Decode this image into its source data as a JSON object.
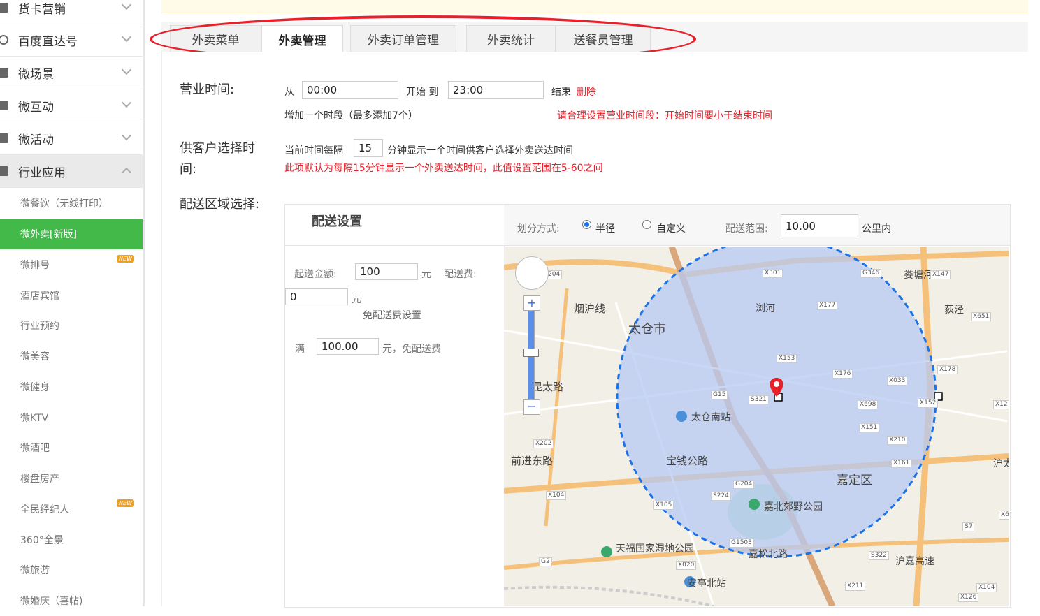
{
  "sidebar": {
    "items": [
      {
        "label": "货卡营销",
        "icon": "card-icon"
      },
      {
        "label": "百度直达号",
        "icon": "baidu-icon"
      },
      {
        "label": "微场景",
        "icon": "scene-icon"
      },
      {
        "label": "微互动",
        "icon": "interact-icon"
      },
      {
        "label": "微活动",
        "icon": "activity-icon"
      },
      {
        "label": "行业应用",
        "icon": "industry-icon"
      }
    ],
    "sub_items": [
      {
        "label": "微餐饮（无线打印）"
      },
      {
        "label": "微外卖[新版]"
      },
      {
        "label": "微排号",
        "badge": "NEW"
      },
      {
        "label": "酒店宾馆"
      },
      {
        "label": "行业预约"
      },
      {
        "label": "微美容"
      },
      {
        "label": "微健身"
      },
      {
        "label": "微KTV"
      },
      {
        "label": "微酒吧"
      },
      {
        "label": "楼盘房产"
      },
      {
        "label": "全民经纪人",
        "badge": "NEW"
      },
      {
        "label": "360°全景"
      },
      {
        "label": "微旅游"
      },
      {
        "label": "微婚庆（喜帖)"
      }
    ]
  },
  "tabs": [
    {
      "label": "外卖菜单"
    },
    {
      "label": "外卖管理"
    },
    {
      "label": "外卖订单管理"
    },
    {
      "label": "外卖统计"
    },
    {
      "label": "送餐员管理"
    }
  ],
  "business_hours": {
    "label": "营业时间:",
    "from": "从",
    "start_value": "00:00",
    "start_to": "开始 到",
    "end_value": "23:00",
    "end": "结束",
    "delete": "删除",
    "add_period": "增加一个时段（最多添加7个）",
    "warning": "请合理设置营业时间段：开始时间要小于结束时间"
  },
  "customer_time": {
    "label_line1": "供客户选择时",
    "label_line2": "间:",
    "prefix": "当前时间每隔",
    "interval_value": "15",
    "suffix": "分钟显示一个时间供客户选择外卖送达时间",
    "note": "此项默认为每隔15分钟显示一个外卖送达时间，此值设置范围在5-60之间"
  },
  "delivery_area": {
    "label": "配送区域选择:",
    "settings_title": "配送设置",
    "min_amount_label": "起送金额:",
    "min_amount_value": "100",
    "unit_yuan": "元",
    "fee_label": "配送费:",
    "fee_value": "0",
    "free_fee_title": "免配送费设置",
    "full_label": "满",
    "full_value": "100.00",
    "full_suffix": "元，免配送费",
    "divide_label": "划分方式:",
    "radius": "半径",
    "custom": "自定义",
    "range_label": "配送范围:",
    "range_value": "10.00",
    "range_unit": "公里内"
  },
  "map": {
    "labels": [
      "太仓市",
      "嘉定区",
      "太仓南站",
      "嘉北郊野公园",
      "天福国家湿地公园",
      "安亭北站",
      "前进东路",
      "昆太路",
      "宝钱公路",
      "烟沪线",
      "嘉松北路",
      "浏河",
      "娄塘河",
      "沪嘉高速",
      "沪太公路",
      "荻泾"
    ],
    "road_codes": [
      "X301",
      "G346",
      "X147",
      "X177",
      "X651",
      "X153",
      "X176",
      "X033",
      "X178",
      "G15",
      "S321",
      "X698",
      "X152",
      "X151",
      "X210",
      "X161",
      "X202",
      "G204",
      "S224",
      "X104",
      "X105",
      "G1503",
      "S7",
      "X020",
      "G2",
      "S322",
      "X211",
      "X126",
      "X104",
      "204",
      "X12",
      "X6"
    ],
    "colors": {
      "circle": "#1a73e8",
      "fill": "#b7c9f3",
      "marker": "#e8202a"
    }
  }
}
